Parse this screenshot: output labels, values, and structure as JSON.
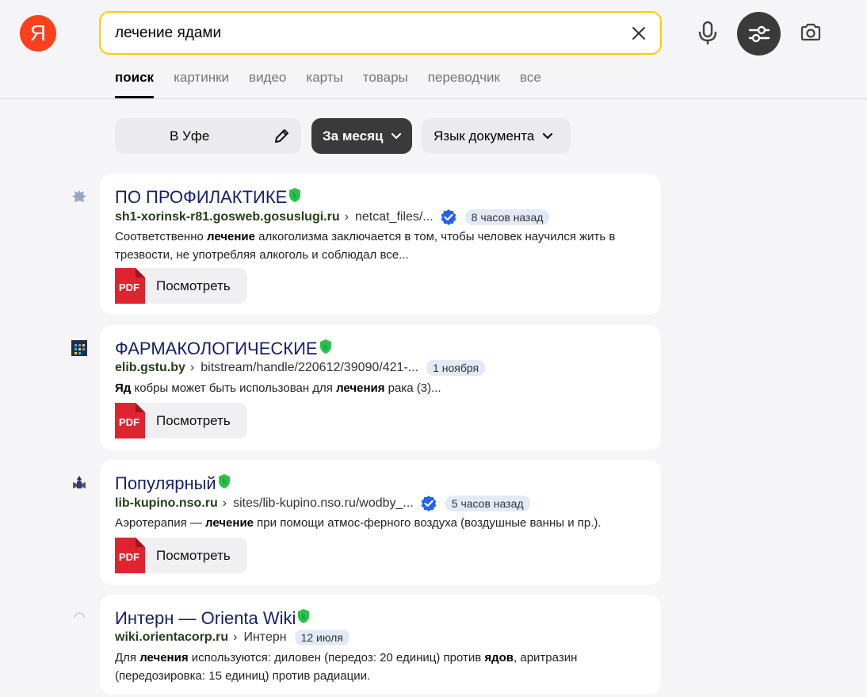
{
  "logo": {
    "glyph": "Я"
  },
  "search": {
    "query": "лечение ядами"
  },
  "tabs": [
    "поиск",
    "картинки",
    "видео",
    "карты",
    "товары",
    "переводчик",
    "все"
  ],
  "filters": {
    "region": "В Уфе",
    "period": "За месяц",
    "language": "Язык документа"
  },
  "view_label": "Посмотреть",
  "pdf_label": "PDF",
  "results": [
    {
      "title": "ПО ПРОФИЛАКТИКЕ",
      "domain": "sh1-xorinsk-r81.gosweb.gosuslugi.ru",
      "path": "netcat_files/...",
      "date": "8 часов назад",
      "snippet": [
        {
          "t": "Соответственно ",
          "b": false
        },
        {
          "t": "лечение",
          "b": true
        },
        {
          "t": " алкоголизма заключается в том, чтобы человек научился жить в трезвости, не употребляя алкоголь и соблюдал все...",
          "b": false
        }
      ]
    },
    {
      "title": "ФАРМАКОЛОГИЧЕСКИЕ",
      "domain": "elib.gstu.by",
      "path": "bitstream/handle/220612/39090/421-...",
      "date": "1 ноября",
      "snippet": [
        {
          "t": "Яд",
          "b": true
        },
        {
          "t": " кобры может быть использован для ",
          "b": false
        },
        {
          "t": "лечения",
          "b": true
        },
        {
          "t": " рака (3)...",
          "b": false
        }
      ]
    },
    {
      "title": "Популярный",
      "domain": "lib-kupino.nso.ru",
      "path": "sites/lib-kupino.nso.ru/wodby_...",
      "date": "5 часов назад",
      "snippet": [
        {
          "t": "Аэротерапия — ",
          "b": false
        },
        {
          "t": "лечение",
          "b": true
        },
        {
          "t": " при помощи атмос-ферного воздуха (воздушные ванны и пр.).",
          "b": false
        }
      ]
    },
    {
      "title": "Интерн — Orienta Wiki",
      "domain": "wiki.orientacorp.ru",
      "path": "Интерн",
      "date": "12 июля",
      "snippet": [
        {
          "t": "Для ",
          "b": false
        },
        {
          "t": "лечения",
          "b": true
        },
        {
          "t": " используются: диловен (передоз: 20 единиц) против ",
          "b": false
        },
        {
          "t": "ядов",
          "b": true
        },
        {
          "t": ", аритразин (передозировка: 15 единиц) против радиации.",
          "b": false
        }
      ]
    }
  ],
  "colors": {
    "logo": "#fc3f1d",
    "search_border": "#ffcc00",
    "dark_button": "#3a3a3a",
    "verified": "#2563eb",
    "shield": "#2fbf4a",
    "pdf": "#e0242f"
  }
}
